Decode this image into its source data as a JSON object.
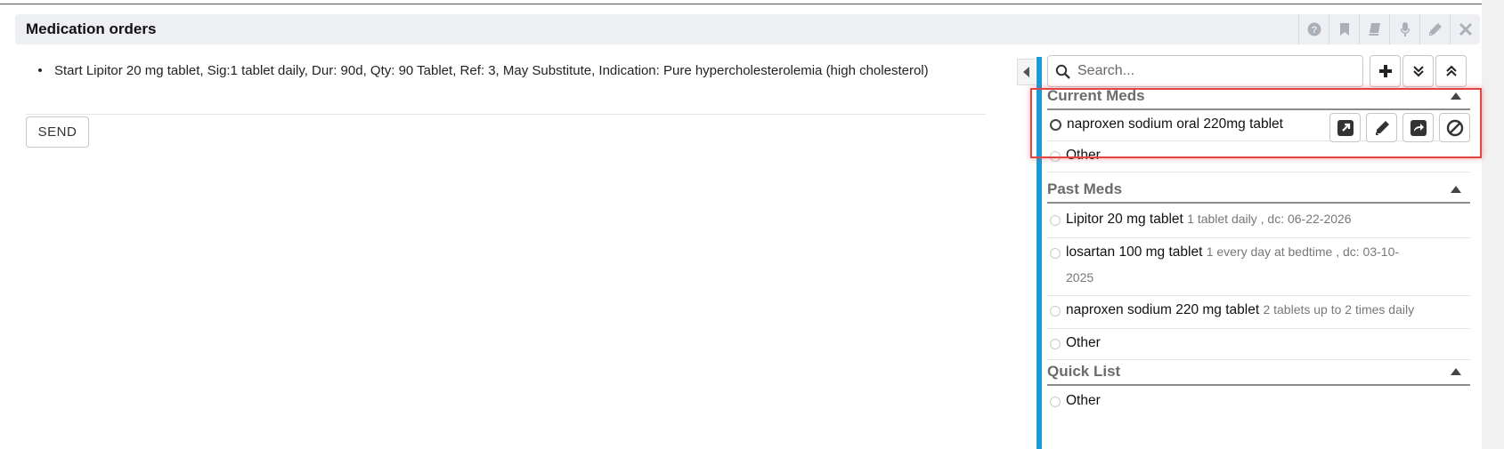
{
  "header": {
    "title": "Medication orders",
    "icons": [
      "help-icon",
      "bookmark-icon",
      "book-icon",
      "microphone-icon",
      "pencil-icon",
      "close-icon"
    ]
  },
  "orders": {
    "items": [
      "Start Lipitor 20 mg tablet, Sig:1 tablet daily, Dur: 90d, Qty: 90 Tablet, Ref: 3, May Substitute, Indication: Pure hypercholesterolemia (high cholesterol)"
    ],
    "send_label": "SEND"
  },
  "search": {
    "placeholder": "Search...",
    "value": ""
  },
  "sections": {
    "current": {
      "title": "Current Meds",
      "meds": [
        {
          "name": "naproxen sodium oral 220mg tablet",
          "detail": ""
        }
      ],
      "other_label": "Other",
      "row_actions": [
        "open-external-icon",
        "edit-icon",
        "renew-icon",
        "discontinue-icon"
      ]
    },
    "past": {
      "title": "Past Meds",
      "meds": [
        {
          "name": "Lipitor 20 mg tablet",
          "detail": "1 tablet daily , dc: 06-22-2026"
        },
        {
          "name": "losartan 100 mg tablet",
          "detail": "1 every day at bedtime , dc: 03-10-2025"
        },
        {
          "name": "naproxen sodium 220 mg tablet",
          "detail": "2 tablets up to 2 times daily"
        }
      ],
      "other_label": "Other"
    },
    "quick": {
      "title": "Quick List",
      "other_label": "Other"
    }
  },
  "colors": {
    "accent_bar": "#1a9ad6",
    "highlight": "#e04444",
    "header_bg": "#eeeff3"
  }
}
